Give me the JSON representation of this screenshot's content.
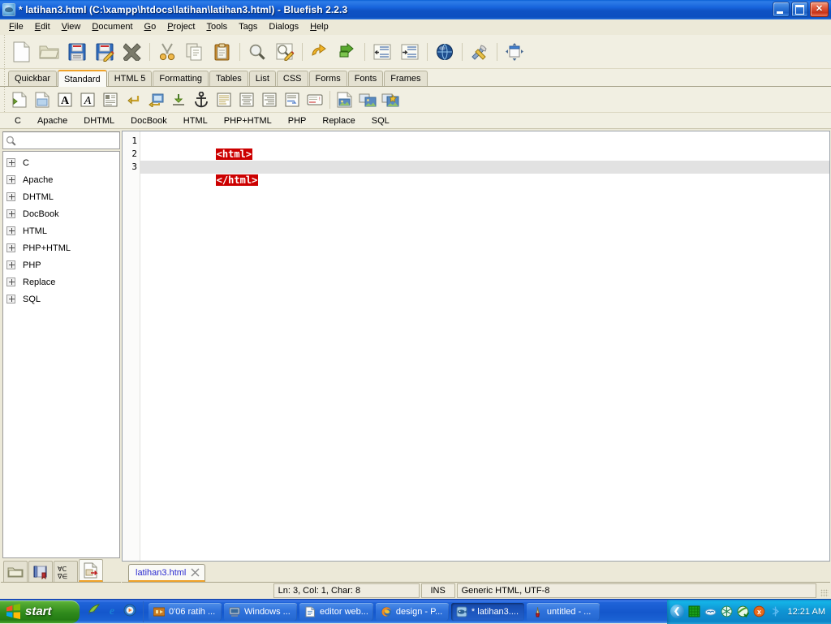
{
  "window": {
    "title": "* latihan3.html (C:\\xampp\\htdocs\\latihan\\latihan3.html) - Bluefish 2.2.3",
    "app_icon": "bluefish-icon",
    "buttons": {
      "minimize": "minimize-icon",
      "restore": "restore-icon",
      "close": "close-icon"
    },
    "titlebar_color": "#0E52C4"
  },
  "menubar": [
    {
      "label": "File",
      "mnemonic": "F"
    },
    {
      "label": "Edit",
      "mnemonic": "E"
    },
    {
      "label": "View",
      "mnemonic": "V"
    },
    {
      "label": "Document",
      "mnemonic": "D"
    },
    {
      "label": "Go",
      "mnemonic": "G"
    },
    {
      "label": "Project",
      "mnemonic": "P"
    },
    {
      "label": "Tools",
      "mnemonic": "T"
    },
    {
      "label": "Tags",
      "mnemonic": "g"
    },
    {
      "label": "Dialogs",
      "mnemonic": "g"
    },
    {
      "label": "Help",
      "mnemonic": "H"
    }
  ],
  "toolbar_main": [
    {
      "name": "new-file-button",
      "tooltip": "New file"
    },
    {
      "name": "open-file-button",
      "tooltip": "Open file"
    },
    {
      "name": "save-file-button",
      "tooltip": "Save file"
    },
    {
      "name": "save-as-button",
      "tooltip": "Save file as"
    },
    {
      "name": "close-file-button",
      "tooltip": "Close file"
    },
    {
      "name": "separator-1",
      "tooltip": ""
    },
    {
      "name": "cut-button",
      "tooltip": "Cut"
    },
    {
      "name": "copy-button",
      "tooltip": "Copy"
    },
    {
      "name": "paste-button",
      "tooltip": "Paste"
    },
    {
      "name": "separator-2",
      "tooltip": ""
    },
    {
      "name": "find-button",
      "tooltip": "Find"
    },
    {
      "name": "find-replace-button",
      "tooltip": "Find and replace"
    },
    {
      "name": "separator-3",
      "tooltip": ""
    },
    {
      "name": "undo-button",
      "tooltip": "Undo"
    },
    {
      "name": "redo-button",
      "tooltip": "Redo"
    },
    {
      "name": "separator-4",
      "tooltip": ""
    },
    {
      "name": "unindent-button",
      "tooltip": "Unindent"
    },
    {
      "name": "indent-button",
      "tooltip": "Indent"
    },
    {
      "name": "separator-5",
      "tooltip": ""
    },
    {
      "name": "preview-browser-button",
      "tooltip": "View in browser"
    },
    {
      "name": "separator-6",
      "tooltip": ""
    },
    {
      "name": "preferences-button",
      "tooltip": "Preferences"
    },
    {
      "name": "separator-7",
      "tooltip": ""
    },
    {
      "name": "fullscreen-button",
      "tooltip": "Fullscreen"
    }
  ],
  "toolbar_standard": [
    {
      "name": "quickstart-button",
      "tooltip": "Quickstart"
    },
    {
      "name": "body-button",
      "tooltip": "Body"
    },
    {
      "name": "bold-button",
      "tooltip": "Bold",
      "glyph": "A"
    },
    {
      "name": "italic-button",
      "tooltip": "Italic",
      "glyph": "A"
    },
    {
      "name": "paragraph-button",
      "tooltip": "Paragraph"
    },
    {
      "name": "break-button",
      "tooltip": "Break"
    },
    {
      "name": "break-clear-button",
      "tooltip": "Break and clear"
    },
    {
      "name": "non-breaking-space-button",
      "tooltip": "Non-breaking space"
    },
    {
      "name": "anchor-button",
      "tooltip": "Anchor"
    },
    {
      "name": "align-left-button",
      "tooltip": "Align left"
    },
    {
      "name": "align-center-button",
      "tooltip": "Center"
    },
    {
      "name": "align-right-button",
      "tooltip": "Align right"
    },
    {
      "name": "horizontal-rule-button",
      "tooltip": "Horizontal rule"
    },
    {
      "name": "comment-button",
      "tooltip": "Comment"
    },
    {
      "name": "separator-8",
      "tooltip": ""
    },
    {
      "name": "insert-image-button",
      "tooltip": "Insert image"
    },
    {
      "name": "thumbnail-button",
      "tooltip": "Insert thumbnail"
    },
    {
      "name": "multi-thumbnail-button",
      "tooltip": "Multi thumbnail"
    }
  ],
  "quickbar_tabs": [
    {
      "label": "Quickbar",
      "active": false
    },
    {
      "label": "Standard",
      "active": true
    },
    {
      "label": "HTML 5",
      "active": false
    },
    {
      "label": "Formatting",
      "active": false
    },
    {
      "label": "Tables",
      "active": false
    },
    {
      "label": "List",
      "active": false
    },
    {
      "label": "CSS",
      "active": false
    },
    {
      "label": "Forms",
      "active": false
    },
    {
      "label": "Fonts",
      "active": false
    },
    {
      "label": "Frames",
      "active": false
    }
  ],
  "snippet_categories": [
    "C",
    "Apache",
    "DHTML",
    "DocBook",
    "HTML",
    "PHP+HTML",
    "PHP",
    "Replace",
    "SQL"
  ],
  "sidebar": {
    "search": {
      "value": "",
      "placeholder": "",
      "icon": "search-icon"
    },
    "tree_items": [
      {
        "label": "C",
        "expanded": false
      },
      {
        "label": "Apache",
        "expanded": false
      },
      {
        "label": "DHTML",
        "expanded": false
      },
      {
        "label": "DocBook",
        "expanded": false
      },
      {
        "label": "HTML",
        "expanded": false
      },
      {
        "label": "PHP+HTML",
        "expanded": false
      },
      {
        "label": "PHP",
        "expanded": false
      },
      {
        "label": "Replace",
        "expanded": false
      },
      {
        "label": "SQL",
        "expanded": false
      }
    ],
    "panel_tabs": [
      {
        "name": "file-browser-tab",
        "icon": "folder-icon",
        "active": false
      },
      {
        "name": "bookmarks-tab",
        "icon": "book-icon",
        "active": false
      },
      {
        "name": "char-map-tab",
        "icon": "symbols-icon",
        "active": false
      },
      {
        "name": "snippets-tab",
        "icon": "snippets-icon",
        "active": true
      }
    ]
  },
  "editor": {
    "lines": [
      {
        "number": "1",
        "text": "<html>",
        "token": true,
        "current": false
      },
      {
        "number": "2",
        "text": "",
        "token": false,
        "current": false
      },
      {
        "number": "3",
        "text": "</html>",
        "token": true,
        "current": true
      }
    ],
    "token_bg": "#cc0000",
    "token_fg": "#ffffff",
    "current_line_bg": "#e2e2e2"
  },
  "document_tabs": [
    {
      "label": "latihan3.html",
      "active": true,
      "close_icon": "close-icon"
    }
  ],
  "statusbar": {
    "position": "Ln: 3, Col: 1, Char: 8",
    "insert_mode": "INS",
    "encoding": "Generic HTML, UTF-8"
  },
  "taskbar": {
    "start_label": "start",
    "start_icon": "windows-flag-icon",
    "quicklaunch": [
      {
        "name": "show-desktop-icon"
      },
      {
        "name": "internet-explorer-icon"
      },
      {
        "name": "media-player-icon"
      }
    ],
    "tasks": [
      {
        "label": "0'06 ratih ...",
        "icon": "winamp-icon",
        "active": false
      },
      {
        "label": "Windows ...",
        "icon": "explorer-icon",
        "active": false
      },
      {
        "label": "editor web...",
        "icon": "notepad-icon",
        "active": false
      },
      {
        "label": "design - P...",
        "icon": "firefox-icon",
        "active": false
      },
      {
        "label": "* latihan3....",
        "icon": "bluefish-icon",
        "active": true
      },
      {
        "label": "untitled - ...",
        "icon": "paint-icon",
        "active": false
      }
    ],
    "tray": {
      "chevron": "chevron-left-icon",
      "icons": [
        {
          "name": "network-grid-icon"
        },
        {
          "name": "cloud-icon"
        },
        {
          "name": "snowflake-icon"
        },
        {
          "name": "antivirus-shield-icon"
        },
        {
          "name": "alert-circle-icon"
        },
        {
          "name": "bluetooth-icon"
        }
      ],
      "clock": "12:21 AM"
    }
  }
}
